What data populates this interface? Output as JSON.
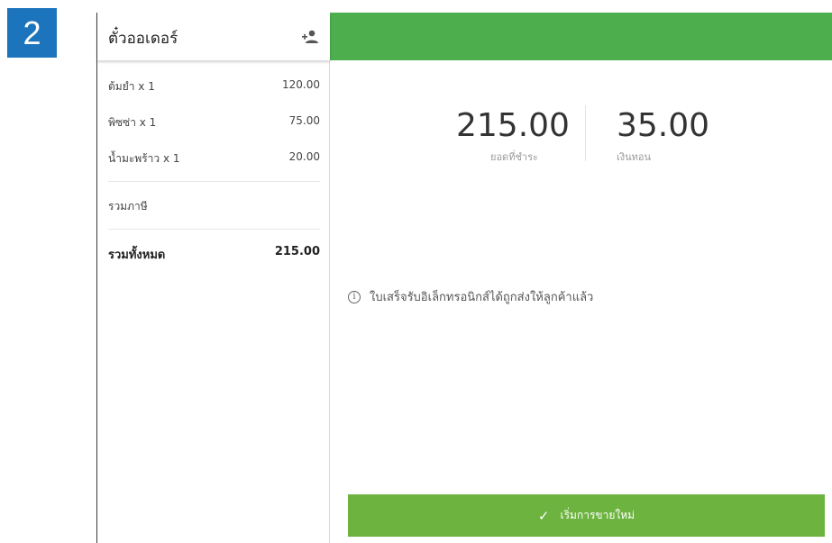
{
  "step": "2",
  "order": {
    "title": "ตั๋วออเดอร์",
    "items": [
      {
        "name": "ต้มยำ x 1",
        "amount": "120.00"
      },
      {
        "name": "พิซซ่า x 1",
        "amount": "75.00"
      },
      {
        "name": "น้ำมะพร้าว x 1",
        "amount": "20.00"
      }
    ],
    "tax_label": "รวมภาษี",
    "total_label": "รวมทั้งหมด",
    "total_amount": "215.00"
  },
  "payment": {
    "amount_due": "215.00",
    "amount_due_label": "ยอดที่ชำระ",
    "change": "35.00",
    "change_label": "เงินทอน"
  },
  "receipt_message": "ใบเสร็จรับอิเล็กทรอนิกส์ได้ถูกส่งให้ลูกค้าแล้ว",
  "new_sale_label": "เริ่มการขายใหม่",
  "colors": {
    "step_badge": "#1c75bc",
    "header_bar": "#4cae4c",
    "new_sale_button": "#6db33f"
  },
  "icons": {
    "add_customer": "add-person-icon",
    "info": "info-icon",
    "check": "checkmark-icon"
  }
}
